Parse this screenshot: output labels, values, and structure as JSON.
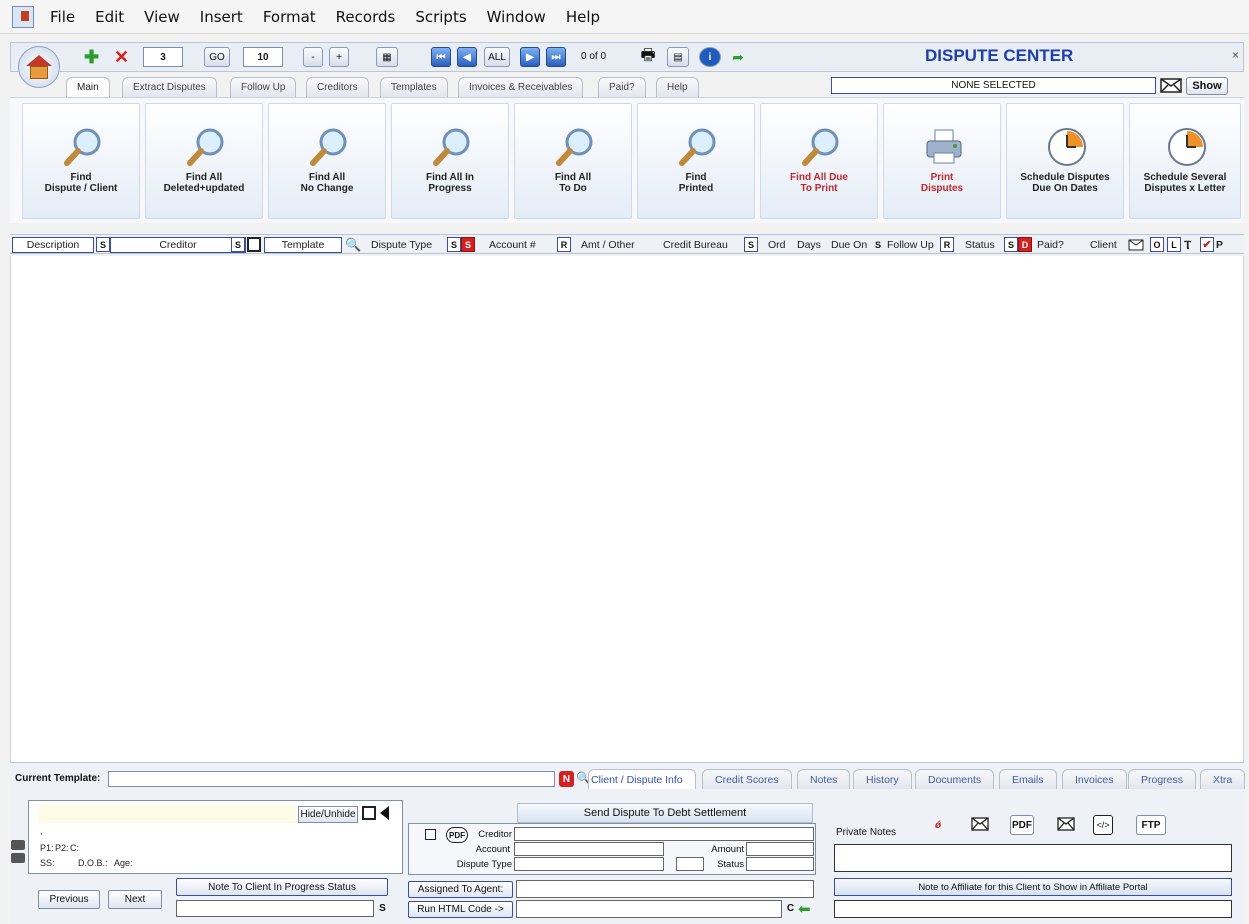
{
  "menu": [
    "File",
    "Edit",
    "View",
    "Insert",
    "Format",
    "Records",
    "Scripts",
    "Window",
    "Help"
  ],
  "toolbar": {
    "record_number": "3",
    "go_label": "GO",
    "page_size": "10",
    "minus_label": "-",
    "plus_label": "+",
    "all_label": "ALL",
    "record_count": "0 of 0",
    "title": "DISPUTE CENTER",
    "close_label": "×"
  },
  "tabs": [
    "Main",
    "Extract Disputes",
    "Follow Up",
    "Creditors",
    "Templates",
    "Invoices & Receivables",
    "Paid?",
    "Help"
  ],
  "selection": {
    "label": "NONE SELECTED",
    "show_label": "Show"
  },
  "actions": [
    {
      "label": "Find\nDispute / Client",
      "icon": "magnifier-icon",
      "color": "normal"
    },
    {
      "label": "Find All\nDeleted+updated",
      "icon": "magnifier-icon",
      "color": "normal"
    },
    {
      "label": "Find All\nNo Change",
      "icon": "magnifier-icon",
      "color": "normal"
    },
    {
      "label": "Find All In\nProgress",
      "icon": "magnifier-icon",
      "color": "normal"
    },
    {
      "label": "Find All\nTo Do",
      "icon": "magnifier-icon",
      "color": "normal"
    },
    {
      "label": "Find\nPrinted",
      "icon": "magnifier-icon",
      "color": "normal"
    },
    {
      "label": "Find All Due\nTo Print",
      "icon": "magnifier-icon",
      "color": "red"
    },
    {
      "label": "Print\nDisputes",
      "icon": "printer-icon",
      "color": "red"
    },
    {
      "label": "Schedule Disputes\nDue On Dates",
      "icon": "clock-icon",
      "color": "normal"
    },
    {
      "label": "Schedule Several\nDisputes x Letter",
      "icon": "clock-icon",
      "color": "normal"
    }
  ],
  "columns": {
    "description": "Description",
    "s": "S",
    "creditor": "Creditor",
    "template": "Template",
    "dispute_type": "Dispute Type",
    "account": "Account #",
    "r": "R",
    "amt_other": "Amt / Other",
    "credit_bureau": "Credit Bureau",
    "ord": "Ord",
    "days": "Days",
    "due_on": "Due On",
    "follow_up": "Follow Up",
    "status": "Status",
    "d": "D",
    "paid": "Paid?",
    "client": "Client",
    "o": "O",
    "l": "L",
    "p": "P"
  },
  "bottom": {
    "current_template_label": "Current Template:",
    "n_badge": "N",
    "tabs": [
      "Client / Dispute Info",
      "Credit Scores",
      "Notes",
      "History",
      "Documents",
      "Emails",
      "Invoices",
      "Progress",
      "Xtra"
    ],
    "client": {
      "name_comma": ",",
      "p1": "P1:",
      "p2": "P2:",
      "c": "C:",
      "ss": "SS:",
      "dob": "D.O.B.:",
      "age": "Age:",
      "hide_unhide": "Hide/Unhide"
    },
    "previous_label": "Previous",
    "next_label": "Next",
    "note_to_client_label": "Note To Client In Progress Status",
    "s_badge": "S",
    "send_dispute_label": "Send Dispute To Debt Settlement",
    "pdf_label": "PDF",
    "creditor_label": "Creditor",
    "account_label": "Account",
    "amount_label": "Amount",
    "dispute_type_label": "Dispute Type",
    "status_label": "Status",
    "assigned_agent_label": "Assigned To Agent:",
    "run_html_label": "Run HTML Code ->",
    "c_badge": "C",
    "private_notes_label": "Private Notes",
    "pdf_icon_label": "PDF",
    "ftp_label": "FTP",
    "affiliate_note_label": "Note to Affiliate for this Client to Show in Affiliate Portal"
  },
  "colors": {
    "accent": "#1d3fae",
    "red": "#c0282d",
    "panel": "#eef1f6"
  }
}
